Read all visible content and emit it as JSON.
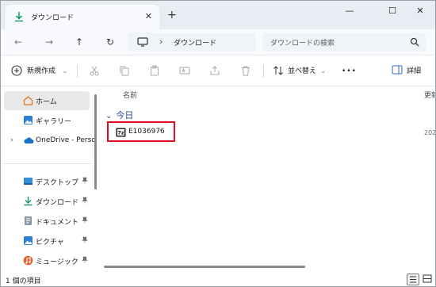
{
  "window": {
    "tab": {
      "title": "ダウンロード",
      "close_glyph": "✕",
      "icon": "download-icon"
    },
    "new_tab_glyph": "+",
    "controls": {
      "minimize": "—",
      "maximize": "☐",
      "close": "✕"
    }
  },
  "nav": {
    "back": "←",
    "forward": "→",
    "up": "↑",
    "refresh": "↻",
    "address": {
      "separator": "›",
      "crumb": "ダウンロード"
    },
    "search": {
      "placeholder": "ダウンロードの検索"
    }
  },
  "commandbar": {
    "new_label": "新規作成",
    "sort_label": "並べ替え",
    "more": "•••",
    "details_label": "詳細",
    "dropdown_glyph": "⌄"
  },
  "sidebar": {
    "items": [
      {
        "label": "ホーム",
        "icon": "home-icon"
      },
      {
        "label": "ギャラリー",
        "icon": "gallery-icon"
      },
      {
        "label": "OneDrive - Perso",
        "icon": "cloud-icon",
        "expander": "›"
      },
      {
        "label": "デスクトップ",
        "icon": "desktop-icon"
      },
      {
        "label": "ダウンロード",
        "icon": "download-icon"
      },
      {
        "label": "ドキュメント",
        "icon": "document-icon"
      },
      {
        "label": "ピクチャ",
        "icon": "pictures-icon"
      },
      {
        "label": "ミュージック",
        "icon": "music-icon"
      }
    ],
    "pin_glyph": "📌"
  },
  "main": {
    "columns": {
      "name": "名前",
      "modified": "更新"
    },
    "group": {
      "chevron": "⌄",
      "label": "今日"
    },
    "files": [
      {
        "name": "E1036976",
        "icon": "7z-archive-icon",
        "date_partial": "202"
      }
    ]
  },
  "status": {
    "item_count": "1 個の項目"
  },
  "colors": {
    "selection_outline": "#e0101a",
    "accent": "#1f4e8c"
  }
}
